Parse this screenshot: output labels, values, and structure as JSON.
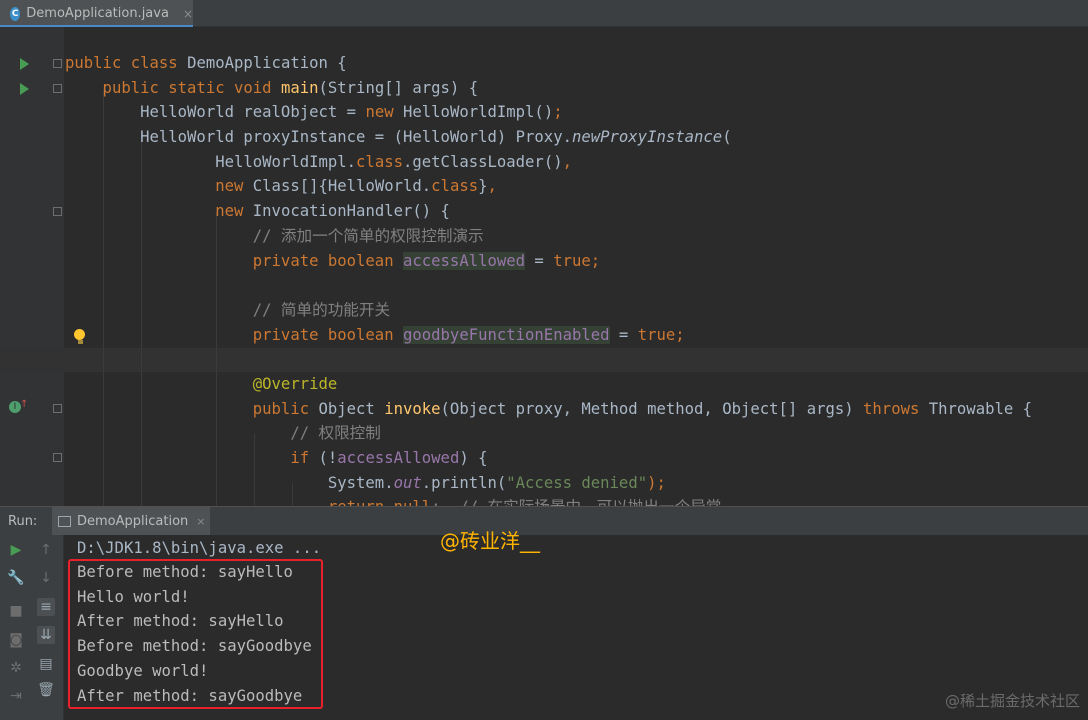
{
  "editor_tab": {
    "filename": "DemoApplication.java",
    "icon": "java-class-icon",
    "close": "×"
  },
  "code_lines": [
    [
      {
        "t": "public class ",
        "c": "kw"
      },
      {
        "t": "DemoApplication {",
        "c": "p"
      }
    ],
    [
      {
        "t": "    public static void ",
        "c": "kw"
      },
      {
        "t": "main",
        "c": "fn"
      },
      {
        "t": "(String[] args) {",
        "c": "p"
      }
    ],
    [
      {
        "t": "        HelloWorld realObject = ",
        "c": "p"
      },
      {
        "t": "new ",
        "c": "kw"
      },
      {
        "t": "HelloWorldImpl()",
        "c": "p"
      },
      {
        "t": ";",
        "c": "kw"
      }
    ],
    [
      {
        "t": "        HelloWorld proxyInstance = (HelloWorld) Proxy.",
        "c": "p"
      },
      {
        "t": "newProxyInstance",
        "c": "it"
      },
      {
        "t": "(",
        "c": "p"
      }
    ],
    [
      {
        "t": "                HelloWorldImpl.",
        "c": "p"
      },
      {
        "t": "class",
        "c": "kw"
      },
      {
        "t": ".getClassLoader()",
        "c": "p"
      },
      {
        "t": ",",
        "c": "kw"
      }
    ],
    [
      {
        "t": "                ",
        "c": "p"
      },
      {
        "t": "new ",
        "c": "kw"
      },
      {
        "t": "Class[]{HelloWorld.",
        "c": "p"
      },
      {
        "t": "class",
        "c": "kw"
      },
      {
        "t": "}",
        "c": "p"
      },
      {
        "t": ",",
        "c": "kw"
      }
    ],
    [
      {
        "t": "                ",
        "c": "p"
      },
      {
        "t": "new ",
        "c": "kw"
      },
      {
        "t": "InvocationHandler() {",
        "c": "p"
      }
    ],
    [
      {
        "t": "                    // 添加一个简单的权限控制演示",
        "c": "cmt"
      }
    ],
    [
      {
        "t": "                    private boolean ",
        "c": "kw"
      },
      {
        "t": "accessAllowed",
        "c": "fldhl"
      },
      {
        "t": " = ",
        "c": "p"
      },
      {
        "t": "true;",
        "c": "kw"
      }
    ],
    [
      {
        "t": "",
        "c": "p"
      }
    ],
    [
      {
        "t": "                    // 简单的功能开关",
        "c": "cmt"
      }
    ],
    [
      {
        "t": "                    private boolean ",
        "c": "kw"
      },
      {
        "t": "goodbyeFunctionEnabled",
        "c": "fldhl"
      },
      {
        "t": " = ",
        "c": "p"
      },
      {
        "t": "true;",
        "c": "kw"
      }
    ],
    [
      {
        "t": "",
        "c": "p"
      }
    ],
    [
      {
        "t": "                    @Override",
        "c": "ann"
      }
    ],
    [
      {
        "t": "                    ",
        "c": "p"
      },
      {
        "t": "public ",
        "c": "kw"
      },
      {
        "t": "Object ",
        "c": "p"
      },
      {
        "t": "invoke",
        "c": "fn"
      },
      {
        "t": "(Object proxy, Method method, Object[] args) ",
        "c": "p"
      },
      {
        "t": "throws ",
        "c": "kw"
      },
      {
        "t": "Throwable {",
        "c": "p"
      }
    ],
    [
      {
        "t": "                        // 权限控制",
        "c": "cmt"
      }
    ],
    [
      {
        "t": "                        ",
        "c": "p"
      },
      {
        "t": "if ",
        "c": "kw"
      },
      {
        "t": "(!",
        "c": "p"
      },
      {
        "t": "accessAllowed",
        "c": "fld"
      },
      {
        "t": ") {",
        "c": "p"
      }
    ],
    [
      {
        "t": "                            System.",
        "c": "p"
      },
      {
        "t": "out",
        "c": "fldit"
      },
      {
        "t": ".println(",
        "c": "p"
      },
      {
        "t": "\"Access denied\"",
        "c": "str"
      },
      {
        "t": ");",
        "c": "kw"
      }
    ],
    [
      {
        "t": "                            ",
        "c": "p"
      },
      {
        "t": "return null",
        "c": "kw"
      },
      {
        "t": ";  // 在实际场景中，可以抛出一个异常",
        "c": "cmt"
      }
    ]
  ],
  "run_panel": {
    "label": "Run:",
    "tab_title": "DemoApplication",
    "tab_close": "×",
    "command": "D:\\JDK1.8\\bin\\java.exe ...",
    "output_lines": [
      "Before method: sayHello",
      "Hello world!",
      "After method: sayHello",
      "Before method: sayGoodbye",
      "Goodbye world!",
      "After method: sayGoodbye"
    ],
    "tools": [
      "run-icon",
      "wrench-icon",
      "stop-icon",
      "camera-icon",
      "exit-icon",
      "soft-wrap-icon",
      "scroll-to-end-icon",
      "print-icon",
      "trash-icon",
      "up-arrow-icon",
      "down-arrow-icon"
    ]
  },
  "watermarks": {
    "author": "@砖业洋__",
    "site": "@稀土掘金技术社区"
  },
  "colors": {
    "highlight_box": "#e8222b",
    "run_green": "#499c54",
    "keyword": "#cc7832"
  }
}
